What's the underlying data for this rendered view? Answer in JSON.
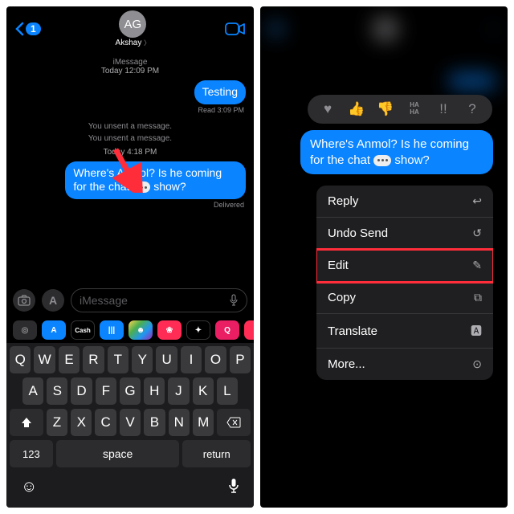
{
  "left": {
    "back_badge": "1",
    "avatar_initials": "AG",
    "contact_name": "Akshay",
    "thread": {
      "meta1_prefix": "iMessage",
      "meta1_time": "Today 12:09 PM",
      "msg1": "Testing",
      "receipt1": "Read 3:09 PM",
      "status1": "You unsent a message.",
      "status2": "You unsent a message.",
      "meta2_time": "Today 4:18 PM",
      "msg2_a": "Where's Anmol? Is he coming for the chat",
      "msg2_b": "show?",
      "receipt2": "Delivered"
    },
    "input_placeholder": "iMessage",
    "apps": [
      {
        "bg": "#2c2c2e",
        "sym": "◎",
        "fg": "#8e8e93"
      },
      {
        "bg": "#0a84ff",
        "sym": "A"
      },
      {
        "bg": "#000",
        "sym": "Cash",
        "fg": "#fff",
        "fs": "8px",
        "bd": "1px solid #333"
      },
      {
        "bg": "#0a84ff",
        "sym": "|||"
      },
      {
        "bg": "linear-gradient(135deg,#ffd54f,#4caf50,#2196f3,#9c27b0)",
        "sym": "☻"
      },
      {
        "bg": "#ff2d55",
        "sym": "❀"
      },
      {
        "bg": "#000",
        "sym": "✦",
        "bd": "1px solid #333"
      },
      {
        "bg": "#e91e63",
        "sym": "Q"
      },
      {
        "bg": "#ff2d55",
        "sym": "♫"
      }
    ],
    "keyboard": {
      "row1": [
        "Q",
        "W",
        "E",
        "R",
        "T",
        "Y",
        "U",
        "I",
        "O",
        "P"
      ],
      "row2": [
        "A",
        "S",
        "D",
        "F",
        "G",
        "H",
        "J",
        "K",
        "L"
      ],
      "row3": [
        "Z",
        "X",
        "C",
        "V",
        "B",
        "N",
        "M"
      ],
      "numkey": "123",
      "space": "space",
      "return": "return"
    }
  },
  "right": {
    "reactions": [
      "♥",
      "👍",
      "👎",
      "HA HA",
      "!!",
      "?"
    ],
    "bubble_a": "Where's Anmol? Is he coming for the chat",
    "bubble_b": "show?",
    "menu": [
      {
        "label": "Reply",
        "icon": "↩"
      },
      {
        "label": "Undo Send",
        "icon": "↺"
      },
      {
        "label": "Edit",
        "icon": "✎",
        "highlight": true
      },
      {
        "label": "Copy",
        "icon": "⧉"
      },
      {
        "label": "Translate",
        "icon": "🅰"
      },
      {
        "label": "More...",
        "icon": "⊙"
      }
    ]
  }
}
